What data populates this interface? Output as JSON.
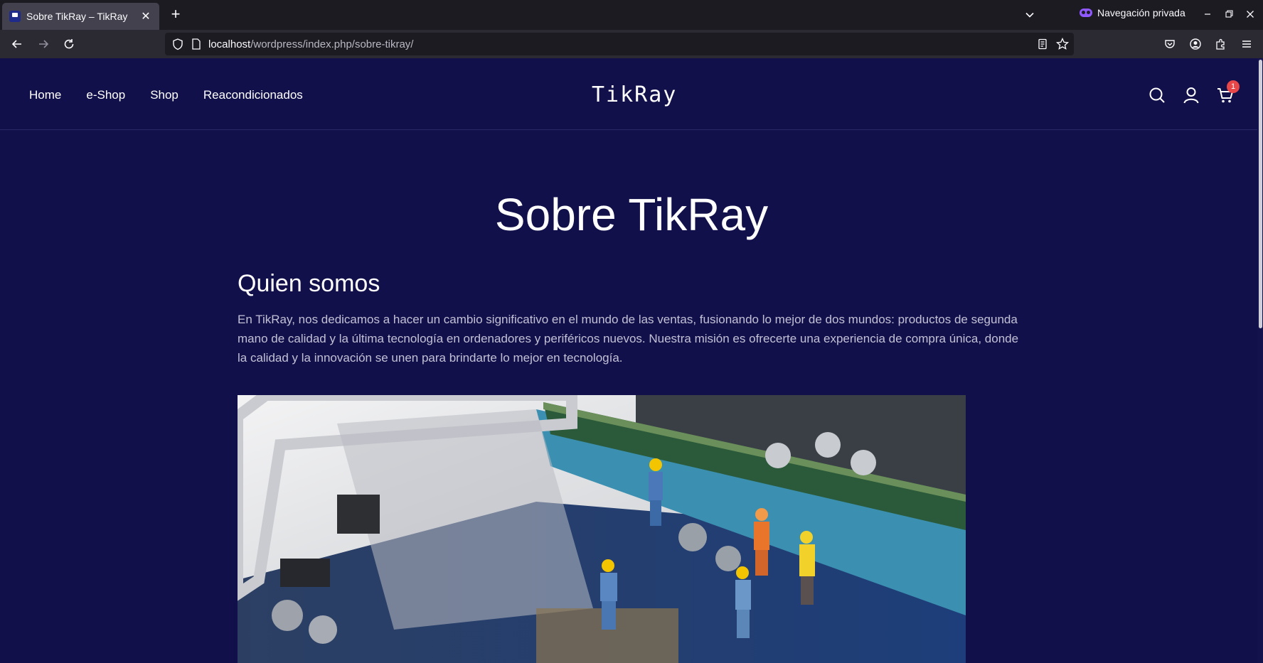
{
  "browser": {
    "tab_title": "Sobre TikRay – TikRay",
    "tab_close": "✕",
    "new_tab": "+",
    "private_label": "Navegación privada",
    "url_host": "localhost",
    "url_path": "/wordpress/index.php/sobre-tikray/"
  },
  "site": {
    "logo": "TikRay",
    "menu": [
      "Home",
      "e-Shop",
      "Shop",
      "Reacondicionados"
    ],
    "cart_count": "1"
  },
  "page": {
    "title": "Sobre TikRay",
    "section_title": "Quien somos",
    "intro": "En TikRay, nos dedicamos a hacer un cambio significativo en el mundo de las ventas, fusionando lo mejor de dos mundos: productos de segunda mano de calidad y la última tecnología en ordenadores y periféricos nuevos. Nuestra misión es ofrecerte una experiencia de compra única, donde la calidad y la innovación se unen para brindarte lo mejor en tecnología."
  },
  "colors": {
    "page_bg": "#12104a",
    "chrome_dark": "#1c1b22",
    "chrome_toolbar": "#2b2a33",
    "private_accent": "#9059ff",
    "badge": "#e8474a"
  }
}
